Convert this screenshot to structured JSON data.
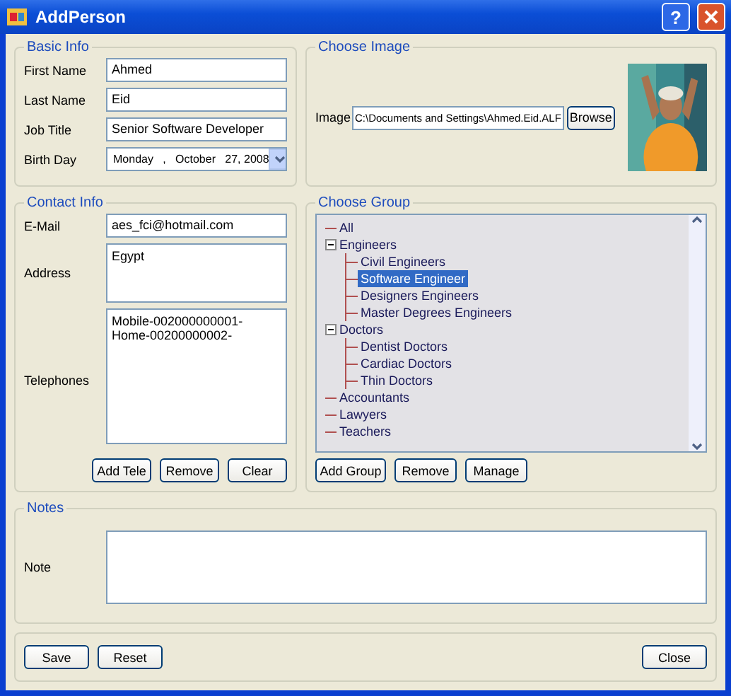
{
  "window": {
    "title": "AddPerson",
    "help_button": "?"
  },
  "basic_info": {
    "title": "Basic Info",
    "fields": [
      {
        "kind": "text",
        "label": "First Name",
        "value": "Ahmed"
      },
      {
        "kind": "text",
        "label": "Last Name",
        "value": "Eid"
      },
      {
        "kind": "text",
        "label": "Job Title",
        "value": "Senior Software Developer"
      },
      {
        "kind": "date",
        "label": "Birth Day",
        "value": "Monday   ,   October   27, 2008"
      }
    ]
  },
  "choose_image": {
    "title": "Choose Image",
    "label": "Image",
    "path": "C:\\Documents and Settings\\Ahmed.Eid.ALF",
    "browse_button": "Browse"
  },
  "contact_info": {
    "title": "Contact Info",
    "email_label": "E-Mail",
    "email": "aes_fci@hotmail.com",
    "address_label": "Address",
    "address": "Egypt",
    "telephones_label": "Telephones",
    "telephones": [
      "Mobile-002000000001-",
      "Home-00200000002-"
    ],
    "buttons": [
      "Add Tele",
      "Remove",
      "Clear"
    ]
  },
  "choose_group": {
    "title": "Choose Group",
    "tree": [
      {
        "label": "All",
        "selected": false
      },
      {
        "label": "Engineers",
        "selected": false,
        "expanded": true,
        "children": [
          {
            "label": "Civil Engineers",
            "selected": false
          },
          {
            "label": "Software Engineer",
            "selected": true
          },
          {
            "label": "Designers Engineers",
            "selected": false
          },
          {
            "label": "Master Degrees Engineers",
            "selected": false
          }
        ]
      },
      {
        "label": "Doctors",
        "selected": false,
        "expanded": true,
        "children": [
          {
            "label": "Dentist Doctors",
            "selected": false
          },
          {
            "label": "Cardiac Doctors",
            "selected": false
          },
          {
            "label": "Thin Doctors",
            "selected": false
          }
        ]
      },
      {
        "label": "Accountants",
        "selected": false
      },
      {
        "label": "Lawyers",
        "selected": false
      },
      {
        "label": "Teachers",
        "selected": false
      }
    ],
    "buttons": [
      "Add Group",
      "Remove",
      "Manage"
    ]
  },
  "notes": {
    "title": "Notes",
    "label": "Note"
  },
  "footer": {
    "left_buttons": [
      "Save",
      "Reset"
    ],
    "right_buttons": [
      "Close"
    ]
  }
}
